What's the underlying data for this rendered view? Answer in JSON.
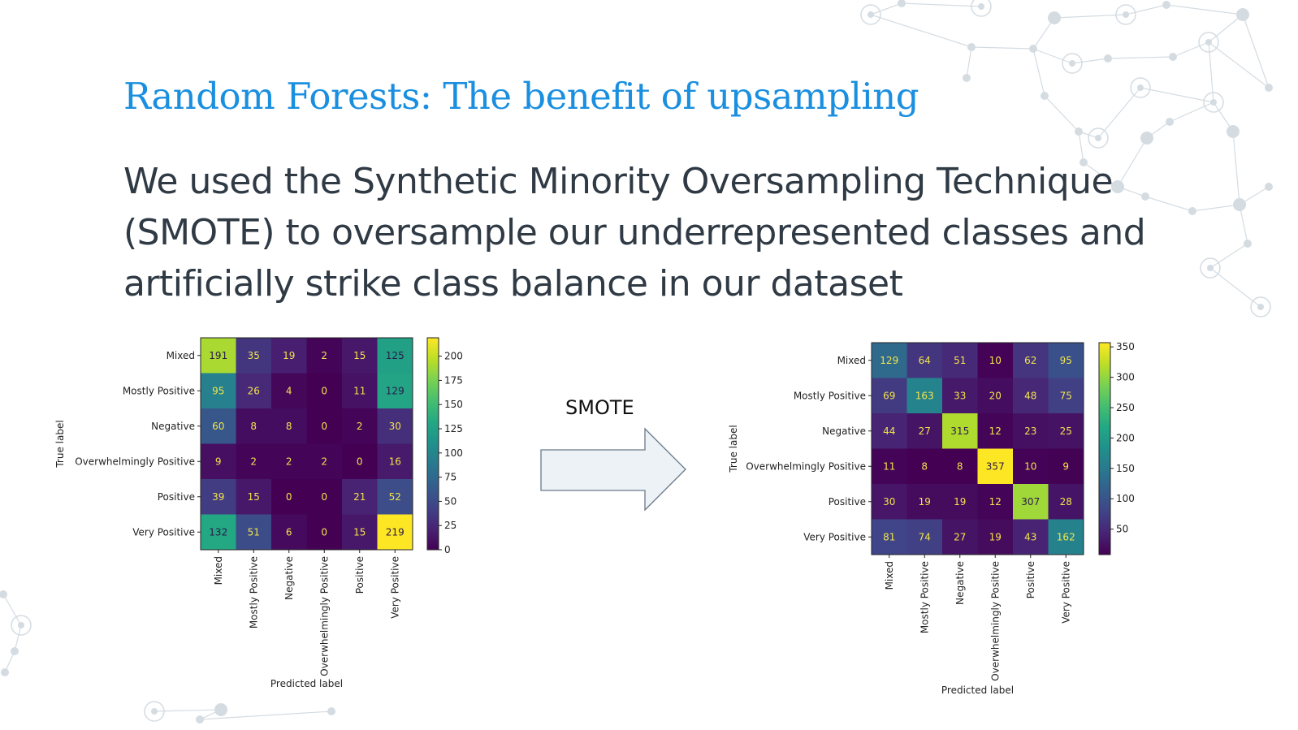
{
  "slide": {
    "title": "Random Forests: The benefit of upsampling",
    "body": "We used the Synthetic Minority Oversampling Technique (SMOTE) to oversample our underrepresented classes and artificially strike class balance in our dataset",
    "arrow_label": "SMOTE"
  },
  "colors": {
    "title": "#1a8fe0",
    "body_text": "#2f3a45",
    "arrow_fill": "#edf2f6",
    "arrow_stroke": "#6a7a88",
    "decor_network": "#d4dce2"
  },
  "chart_data": [
    {
      "type": "heatmap",
      "name": "before-smote",
      "labels": [
        "Mixed",
        "Mostly Positive",
        "Negative",
        "Overwhelmingly Positive",
        "Positive",
        "Very Positive"
      ],
      "matrix": [
        [
          191,
          35,
          19,
          2,
          15,
          125
        ],
        [
          95,
          26,
          4,
          0,
          11,
          129
        ],
        [
          60,
          8,
          8,
          0,
          2,
          30
        ],
        [
          9,
          2,
          2,
          2,
          0,
          16
        ],
        [
          39,
          15,
          0,
          0,
          21,
          52
        ],
        [
          132,
          51,
          6,
          0,
          15,
          219
        ]
      ],
      "xlabel": "Predicted label",
      "ylabel": "True label",
      "colorbar_ticks": [
        0,
        25,
        50,
        75,
        100,
        125,
        150,
        175,
        200
      ],
      "colorbar_range": [
        0,
        219
      ],
      "colormap": "viridis"
    },
    {
      "type": "heatmap",
      "name": "after-smote",
      "labels": [
        "Mixed",
        "Mostly Positive",
        "Negative",
        "Overwhelmingly Positive",
        "Positive",
        "Very Positive"
      ],
      "matrix": [
        [
          129,
          64,
          51,
          10,
          62,
          95
        ],
        [
          69,
          163,
          33,
          20,
          48,
          75
        ],
        [
          44,
          27,
          315,
          12,
          23,
          25
        ],
        [
          11,
          8,
          8,
          357,
          10,
          9
        ],
        [
          30,
          19,
          19,
          12,
          307,
          28
        ],
        [
          81,
          74,
          27,
          19,
          43,
          162
        ]
      ],
      "xlabel": "Predicted label",
      "ylabel": "True label",
      "colorbar_ticks": [
        50,
        100,
        150,
        200,
        250,
        300,
        350
      ],
      "colorbar_range": [
        8,
        357
      ],
      "colormap": "viridis"
    }
  ]
}
